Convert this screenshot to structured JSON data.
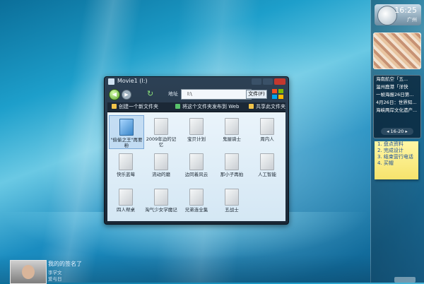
{
  "sidebar": {
    "clock": {
      "time": "16:25",
      "city": "广州"
    },
    "news": {
      "items": [
        "海南航空「五...",
        "温州鹿港「洋快",
        "一帧海报26日第...",
        "4月26日：世界知...",
        "海峡两岸文化遗产..."
      ],
      "nav": "◂ 16-20 ▸"
    },
    "note": {
      "items": [
        "1. 盘点资料",
        "2. 完成设计",
        "3. 结束营行电话",
        "4. 买帽"
      ]
    }
  },
  "window": {
    "title": "Movie1 (I:)",
    "address_label": "地址",
    "address_value": "I:\\",
    "file_menu": "文件(F)",
    "commands": [
      "创建一个新文件夹",
      "将这个文件夹发布到 Web",
      "共享此文件夹"
    ],
    "items": [
      "\"偷偷之王\"再要粉",
      "2009年边的记忆",
      "宝贝计划",
      "鬼屋骑士",
      "周内人",
      "快乐蓝莓",
      "流动的磨",
      "边同着风云",
      "那小子再拍",
      "人工智能",
      "四人帮桌",
      "淘气少女学魔记",
      "兄弟连全集",
      "五战士"
    ]
  },
  "user": {
    "status": "我的的签名了",
    "line1": "李学文",
    "line2": "爱与日"
  }
}
